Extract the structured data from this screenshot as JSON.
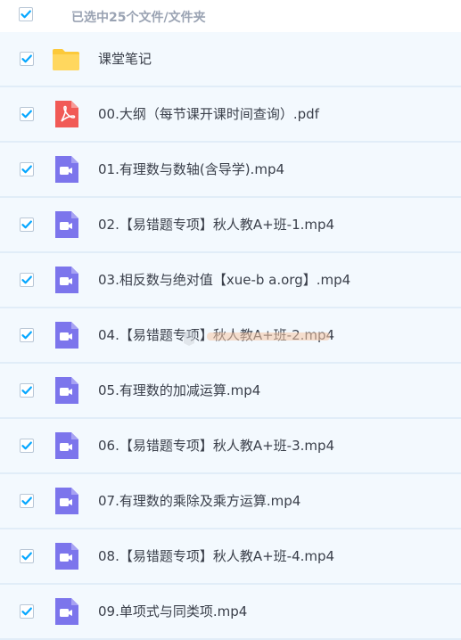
{
  "header": {
    "selection_text": "已选中25个文件/文件夹"
  },
  "files": [
    {
      "name": "课堂笔记",
      "type": "folder"
    },
    {
      "name": "00.大纲（每节课开课时间查询）.pdf",
      "type": "pdf"
    },
    {
      "name": "01.有理数与数轴(含导学).mp4",
      "type": "video"
    },
    {
      "name": "02.【易错题专项】秋人教A+班-1.mp4",
      "type": "video"
    },
    {
      "name": "03.相反数与绝对值【xue-b a.org】.mp4",
      "type": "video"
    },
    {
      "name": "04.【易错题专项】秋人教A+班-2.mp4",
      "type": "video"
    },
    {
      "name": "05.有理数的加减运算.mp4",
      "type": "video"
    },
    {
      "name": "06.【易错题专项】秋人教A+班-3.mp4",
      "type": "video"
    },
    {
      "name": "07.有理数的乘除及乘方运算.mp4",
      "type": "video"
    },
    {
      "name": "08.【易错题专项】秋人教A+班-4.mp4",
      "type": "video"
    },
    {
      "name": "09.单项式与同类项.mp4",
      "type": "video"
    }
  ],
  "colors": {
    "accent": "#06a7ff",
    "folder": "#fcc93a",
    "pdf": "#f15a56",
    "video": "#7c75ec",
    "row_bg": "#f3f9fe"
  }
}
